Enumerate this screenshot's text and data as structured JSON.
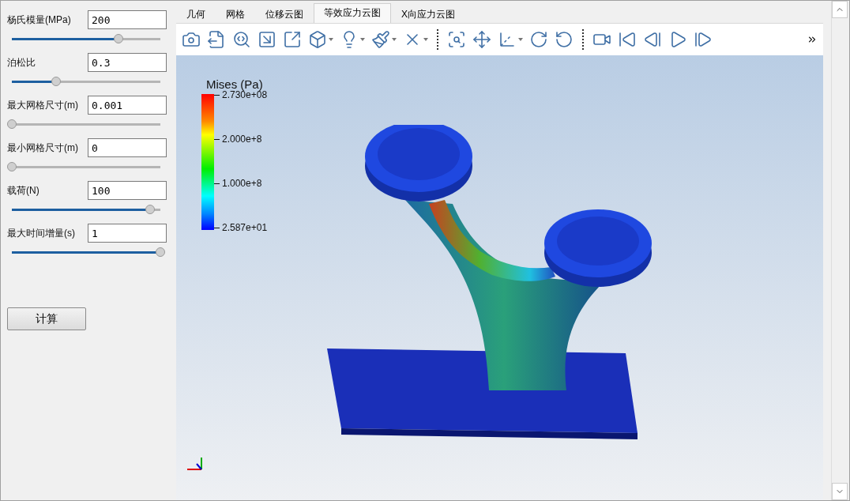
{
  "parameters": [
    {
      "label": "杨氏模量(MPa)",
      "value": "200",
      "level": 0.72
    },
    {
      "label": "泊松比",
      "value": "0.3",
      "level": 0.3
    },
    {
      "label": "最大网格尺寸(m)",
      "value": "0.001",
      "level": 0
    },
    {
      "label": "最小网格尺寸(m)",
      "value": "0",
      "level": 0
    },
    {
      "label": "载荷(N)",
      "value": "100",
      "level": 0.93
    },
    {
      "label": "最大时间增量(s)",
      "value": "1",
      "level": 1
    }
  ],
  "compute_button": "计算",
  "tabs": [
    {
      "label": "几何",
      "selected": false
    },
    {
      "label": "网格",
      "selected": false
    },
    {
      "label": "位移云图",
      "selected": false
    },
    {
      "label": "等效应力云图",
      "selected": true
    },
    {
      "label": "X向应力云图",
      "selected": false
    }
  ],
  "legend": {
    "title": "Mises (Pa)",
    "ticks": [
      "2.730e+08",
      "2.000e+8",
      "1.000e+8",
      "2.587e+01"
    ]
  }
}
